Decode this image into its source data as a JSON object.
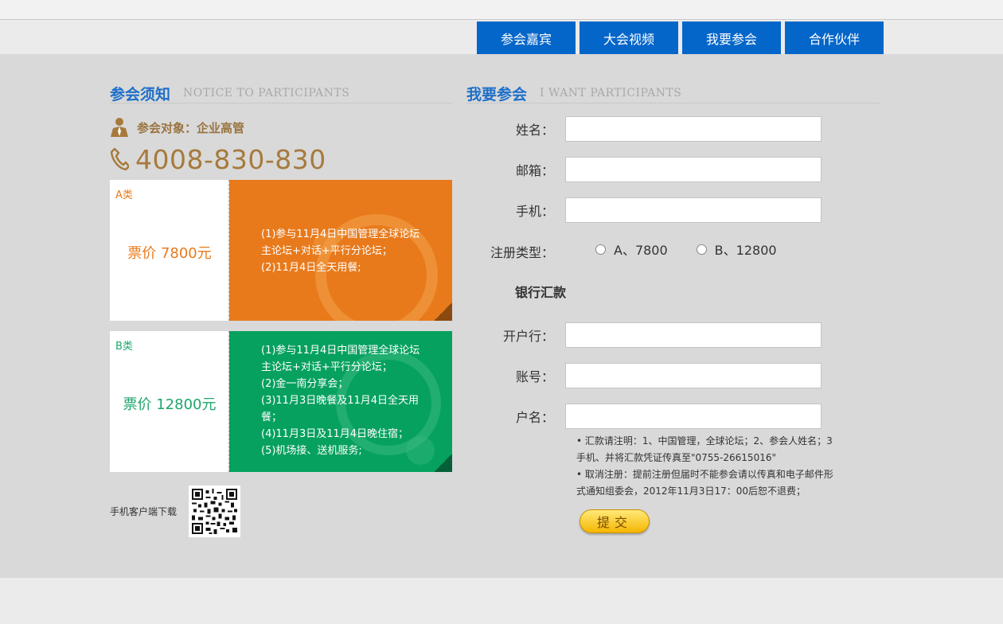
{
  "nav": {
    "items": [
      "参会嘉宾",
      "大会视频",
      "我要参会",
      "合作伙伴"
    ]
  },
  "notice": {
    "title_cn": "参会须知",
    "title_en": "NOTICE TO PARTICIPANTS",
    "target_text": "参会对象：企业高管",
    "phone": "4008-830-830"
  },
  "tickets": [
    {
      "cls": "A类",
      "price": "票价  7800元",
      "desc": [
        "(1)参与11月4日中国管理全球论坛主论坛+对话+平行分论坛；",
        "(2)11月4日全天用餐;"
      ]
    },
    {
      "cls": "B类",
      "price": "票价  12800元",
      "desc": [
        "(1)参与11月4日中国管理全球论坛主论坛+对话+平行分论坛；",
        "(2)金一南分享会；",
        "(3)11月3日晚餐及11月4日全天用餐；",
        "(4)11月3日及11月4日晚住宿；",
        "(5)机场接、送机服务;"
      ]
    }
  ],
  "qr": {
    "label": "手机客户端下载"
  },
  "register": {
    "title_cn": "我要参会",
    "title_en": "I WANT PARTICIPANTS",
    "name_label": "姓名：",
    "email_label": "邮箱：",
    "mobile_label": "手机：",
    "type_label": "注册类型：",
    "option_a": "A、7800",
    "option_b": "B、12800",
    "bank_title": "银行汇款",
    "bank_label": "开户行：",
    "account_label": "账号：",
    "holder_label": "户名：",
    "note1": "• 汇款请注明：1、中国管理，全球论坛；2、参会人姓名；3手机、并将汇款凭证传真至\"0755-26615016\"",
    "note2": "• 取消注册：提前注册但届时不能参会请以传真和电子邮件形式通知组委会，2012年11月3日17：00后恕不退费；",
    "submit": "提交"
  },
  "colors": {
    "nav_blue": "#0566c9",
    "title_blue": "#1e6fc9",
    "orange": "#e87a1c",
    "green": "#06a15f",
    "gold": "#a67a3d"
  }
}
